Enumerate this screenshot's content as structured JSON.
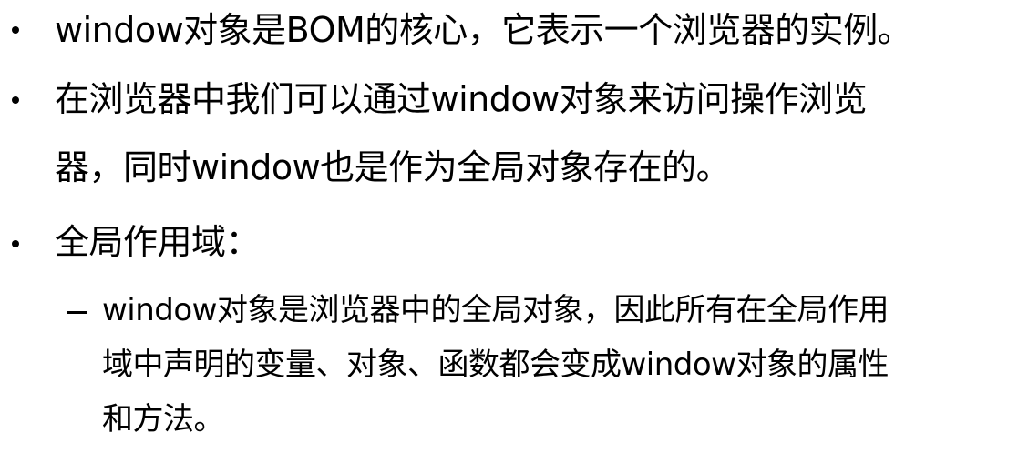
{
  "bullets": [
    {
      "lines": [
        "window对象是BOM的核心，它表示一个浏览器的实例。"
      ]
    },
    {
      "lines": [
        "在浏览器中我们可以通过window对象来访问操作浏览",
        "器，同时window也是作为全局对象存在的。"
      ]
    },
    {
      "lines": [
        "全局作用域："
      ],
      "sub": {
        "lines": [
          "window对象是浏览器中的全局对象，因此所有在全局作用",
          "域中声明的变量、对象、函数都会变成window对象的属性",
          "和方法。"
        ]
      }
    }
  ]
}
